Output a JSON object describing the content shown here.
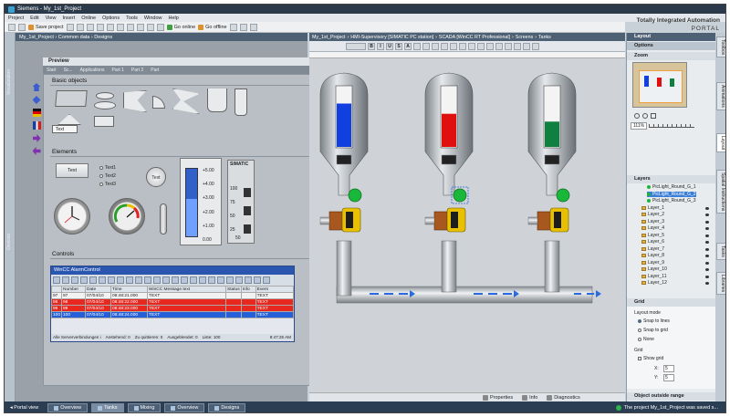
{
  "window": {
    "title": "Siemens  -  My_1st_Project"
  },
  "brand": {
    "line1": "Totally Integrated Automation",
    "line2": "PORTAL"
  },
  "menu": [
    "Project",
    "Edit",
    "View",
    "Insert",
    "Online",
    "Options",
    "Tools",
    "Window",
    "Help"
  ],
  "toolbar": {
    "save": "Save project",
    "go_online": "Go online",
    "go_offline": "Go offline"
  },
  "left_strip": {
    "top": "Visualization",
    "bottom": "Devices"
  },
  "left_editor": {
    "breadcrumb": "My_1st_Project  ›  Common data  ›  Designs",
    "preview": "Preview",
    "subtabs": [
      "Start",
      "Sc...",
      "Applications",
      "Part 1",
      "Part 2",
      "Part"
    ],
    "basic_objects": "Basic objects",
    "text_label": "Text",
    "elements": "Elements",
    "elem_button": "Text",
    "elem_radio": [
      "Text1",
      "Text2",
      "Text3"
    ],
    "elem_round": "Text",
    "bar_scale": [
      "+5.00",
      "+4.00",
      "+3.00",
      "+2.00",
      "+1.00",
      "0.00"
    ],
    "bar_level": 0.55,
    "simatic": {
      "title": "SIMATIC",
      "scale": [
        "100",
        "75",
        "50",
        "25"
      ],
      "bottom": "50"
    },
    "controls": "Controls"
  },
  "alarm": {
    "title": "WinCC AlarmControl",
    "columns": [
      "",
      "Number",
      "Date",
      "Time",
      "WinCC Message text",
      "Status",
      "Info",
      "Event"
    ],
    "rows": [
      {
        "n": "97",
        "num": "97",
        "date": "07/04/10",
        "time": "08:48:21.000",
        "text": "TEXT",
        "status": "",
        "info": "",
        "event": "TEXT"
      },
      {
        "n": "98",
        "num": "98",
        "date": "07/04/10",
        "time": "08:48:22.000",
        "text": "TEXT",
        "status": "",
        "info": "",
        "event": "TEXT"
      },
      {
        "n": "99",
        "num": "99",
        "date": "07/04/10",
        "time": "08:48:23.000",
        "text": "TEXT",
        "status": "",
        "info": "",
        "event": "TEXT"
      },
      {
        "n": "100",
        "num": "100",
        "date": "07/04/10",
        "time": "08:48:24.000",
        "text": "TEXT",
        "status": "",
        "info": "",
        "event": "TEXT"
      }
    ],
    "row_colors": [
      "#f2f2f2",
      "#e8271f",
      "#e8271f",
      "#2560d8"
    ],
    "footer": [
      "Alle Serververbindungen i",
      "Anstehend: 0",
      "Zu quittieren: 0",
      "Ausgeblendet: 0",
      "Liste: 100",
      "8:47:25 AM"
    ]
  },
  "center_editor": {
    "breadcrumb": [
      "My_1st_Project",
      "HMI-Supervisory [SIMATIC PC station]",
      "SCADA [WinCC RT Professional]",
      "Screens",
      "Tanks"
    ],
    "toolbar_btns": [
      "B",
      "I",
      "U",
      "S",
      "A"
    ]
  },
  "tanks": [
    {
      "level": 0.72,
      "color": "#1040e0"
    },
    {
      "level": 0.55,
      "color": "#e01010"
    },
    {
      "level": 0.42,
      "color": "#108040"
    }
  ],
  "inspector": {
    "properties": "Properties",
    "info": "Info",
    "diagnostics": "Diagnostics"
  },
  "right_panel": {
    "title": "Layout",
    "options": "Options",
    "zoom": "Zoom",
    "zoom_value": "111%",
    "layers": "Layers",
    "objects": [
      "PicLight_Round_G_1",
      "PicLight_Round_G_2",
      "PicLight_Round_G_3"
    ],
    "layer_list": [
      "Layer_1",
      "Layer_2",
      "Layer_3",
      "Layer_4",
      "Layer_5",
      "Layer_6",
      "Layer_7",
      "Layer_8",
      "Layer_9",
      "Layer_10",
      "Layer_11",
      "Layer_12"
    ],
    "grid": "Grid",
    "layout_mode": "Layout mode",
    "snap_lines": "Snap to lines",
    "snap_grid": "Snap to grid",
    "none": "None",
    "grid_sub": "Grid",
    "show_grid": "Show grid",
    "x_label": "X:",
    "y_label": "Y:",
    "x_value": "5",
    "y_value": "5",
    "outside": "Object outside range"
  },
  "right_tabs": [
    "Toolbox",
    "Animations",
    "Layout",
    "Spatial Instructions",
    "Tasks",
    "Libraries"
  ],
  "statusbar": {
    "portal": "Portal view",
    "tabs": [
      "Overview",
      "Tanks",
      "Mixing",
      "Overview",
      "Designs"
    ],
    "message": "The project My_1st_Project was saved s..."
  }
}
